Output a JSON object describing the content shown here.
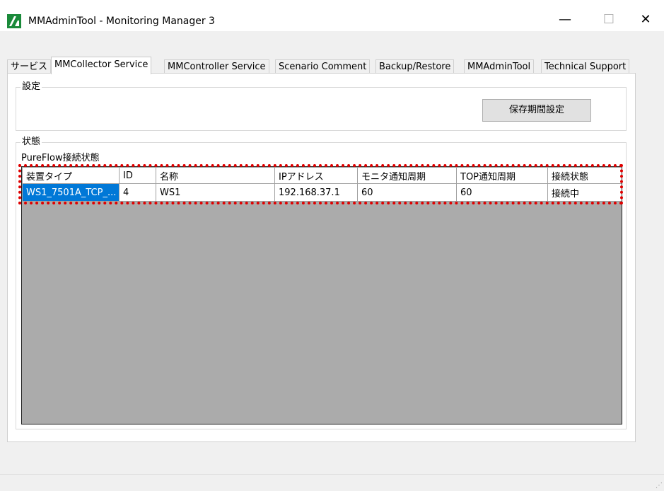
{
  "window": {
    "title": "MMAdminTool - Monitoring Manager 3",
    "controls": {
      "minimize": "—",
      "maximize": "☐",
      "close": "✕"
    }
  },
  "tabs": [
    {
      "label": "サービス",
      "active": false
    },
    {
      "label": "MMCollector Service",
      "active": true
    },
    {
      "label": "MMController Service",
      "active": false
    },
    {
      "label": "Scenario Comment",
      "active": false
    },
    {
      "label": "Backup/Restore",
      "active": false
    },
    {
      "label": "MMAdminTool",
      "active": false
    },
    {
      "label": "Technical Support",
      "active": false
    }
  ],
  "settings": {
    "legend": "設定",
    "retention_button": "保存期間設定"
  },
  "status": {
    "legend": "状態",
    "subtitle": "PureFlow接続状態",
    "columns": [
      "装置タイプ",
      "ID",
      "名称",
      "IPアドレス",
      "モニタ通知周期",
      "TOP通知周期",
      "接続状態"
    ],
    "rows": [
      [
        "WS1_7501A_TCP_...",
        "4",
        "WS1",
        "192.168.37.1",
        "60",
        "60",
        "接続中"
      ]
    ]
  },
  "colors": {
    "selection": "#0078d7",
    "highlight": "#e00000",
    "grid_background": "#ababab",
    "logo": "#1a8a3a"
  }
}
